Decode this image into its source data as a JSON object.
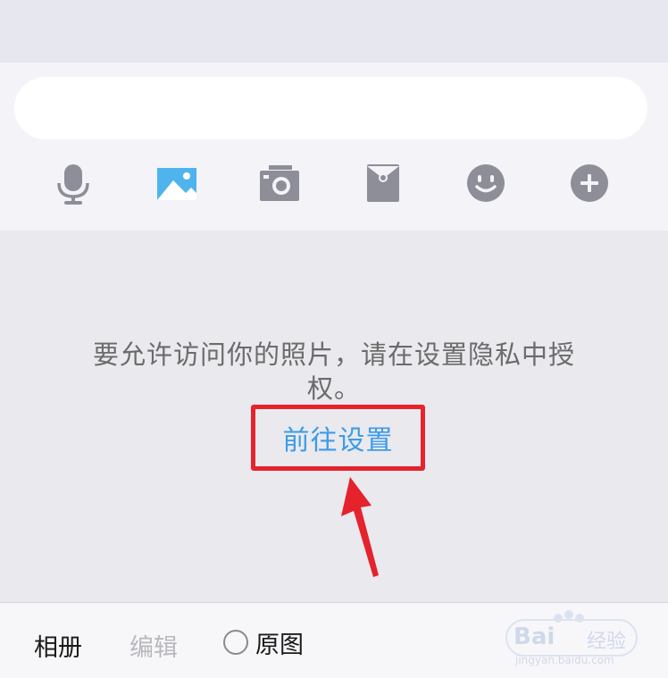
{
  "composer": {
    "input_value": "",
    "input_placeholder": ""
  },
  "toolbar": {
    "items": [
      {
        "name": "voice",
        "icon": "microphone-icon"
      },
      {
        "name": "photo",
        "icon": "image-icon",
        "active": true
      },
      {
        "name": "camera",
        "icon": "camera-icon"
      },
      {
        "name": "red_packet",
        "icon": "red-envelope-icon"
      },
      {
        "name": "emoji",
        "icon": "smiley-icon"
      },
      {
        "name": "more",
        "icon": "plus-circle-icon"
      }
    ],
    "colors": {
      "icon": "#8e8e99",
      "active": "#4fb4ee"
    }
  },
  "permission": {
    "message": "要允许访问你的照片，请在设置隐私中授权。",
    "link_label": "前往设置",
    "link_color": "#3c9be8",
    "highlight_color": "#e4232d"
  },
  "bottom_bar": {
    "album_label": "相册",
    "edit_label": "编辑",
    "original_label": "原图",
    "original_checked": false
  },
  "watermark": {
    "brand": "Bai",
    "brand_cn": "经验",
    "url": "jingyan.baidu.com"
  }
}
